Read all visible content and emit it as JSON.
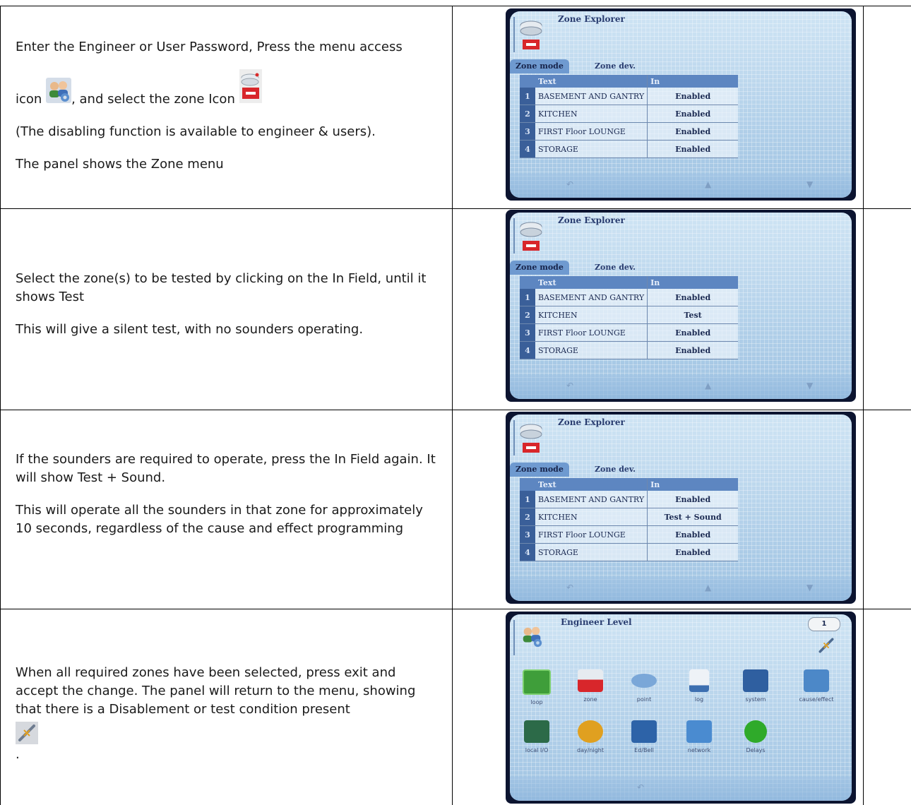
{
  "rows": [
    {
      "paragraphs": [
        [
          "Enter the Engineer or User Password, Press the menu access"
        ],
        [
          "icon",
          ", and select the zone Icon"
        ],
        [
          "(The disabling function is available to engineer & users)."
        ],
        [
          "The panel shows the Zone menu"
        ]
      ],
      "icons": [
        "menu-access-icon",
        "zone-icon"
      ]
    },
    {
      "paragraphs": [
        [
          "Select the zone(s) to be tested by clicking on the In Field, until it shows Test"
        ],
        [
          "This will give a silent test, with no sounders operating."
        ]
      ]
    },
    {
      "paragraphs": [
        [
          "If the sounders are required to operate, press the In Field again. It will show Test + Sound."
        ],
        [
          "This will operate all the sounders in that zone for approximately 10 seconds, regardless of the cause and effect programming"
        ]
      ]
    },
    {
      "paragraphs": [
        [
          "When all required zones have been selected, press exit and accept the change. The panel will return to the menu, showing that there is a Disablement or test condition present"
        ],
        [
          "."
        ]
      ],
      "icons": [
        "disablement-icon"
      ]
    }
  ],
  "zone_screens": [
    {
      "title": "Zone Explorer",
      "tabs": [
        "Zone mode",
        "Zone dev."
      ],
      "headers": [
        "Text",
        "In"
      ],
      "zones": [
        {
          "n": "1",
          "name": "BASEMENT AND GANTRY",
          "status": "Enabled"
        },
        {
          "n": "2",
          "name": "KITCHEN",
          "status": "Enabled"
        },
        {
          "n": "3",
          "name": "FIRST Floor LOUNGE",
          "status": "Enabled"
        },
        {
          "n": "4",
          "name": "STORAGE",
          "status": "Enabled"
        }
      ]
    },
    {
      "title": "Zone Explorer",
      "tabs": [
        "Zone mode",
        "Zone dev."
      ],
      "headers": [
        "Text",
        "In"
      ],
      "zones": [
        {
          "n": "1",
          "name": "BASEMENT AND GANTRY",
          "status": "Enabled"
        },
        {
          "n": "2",
          "name": "KITCHEN",
          "status": "Test"
        },
        {
          "n": "3",
          "name": "FIRST Floor LOUNGE",
          "status": "Enabled"
        },
        {
          "n": "4",
          "name": "STORAGE",
          "status": "Enabled"
        }
      ]
    },
    {
      "title": "Zone Explorer",
      "tabs": [
        "Zone mode",
        "Zone dev."
      ],
      "headers": [
        "Text",
        "In"
      ],
      "zones": [
        {
          "n": "1",
          "name": "BASEMENT AND GANTRY",
          "status": "Enabled"
        },
        {
          "n": "2",
          "name": "KITCHEN",
          "status": "Test + Sound"
        },
        {
          "n": "3",
          "name": "FIRST Floor LOUNGE",
          "status": "Enabled"
        },
        {
          "n": "4",
          "name": "STORAGE",
          "status": "Enabled"
        }
      ]
    }
  ],
  "engineer_screen": {
    "title": "Engineer Level",
    "badge": "1",
    "menu": [
      {
        "label": "loop",
        "icon": "loop-icon",
        "color": "#3f9e3a"
      },
      {
        "label": "zone",
        "icon": "zone-icon",
        "color": "#d8262b"
      },
      {
        "label": "point",
        "icon": "point-icon",
        "color": "#7aa7d8"
      },
      {
        "label": "log",
        "icon": "log-icon",
        "color": "#3d6fb0"
      },
      {
        "label": "system",
        "icon": "system-icon",
        "color": "#2f5fa0"
      },
      {
        "label": "cause/effect",
        "icon": "cause-effect-icon",
        "color": "#4c88c8"
      },
      {
        "label": "local I/O",
        "icon": "local-io-icon",
        "color": "#2c6a48"
      },
      {
        "label": "day/night",
        "icon": "day-night-icon",
        "color": "#e0a020"
      },
      {
        "label": "Ed/Bell",
        "icon": "ed-bell-icon",
        "color": "#2d63a8"
      },
      {
        "label": "network",
        "icon": "network-icon",
        "color": "#4a8bd0"
      },
      {
        "label": "Delays",
        "icon": "delays-icon",
        "color": "#2faa2a"
      }
    ]
  }
}
